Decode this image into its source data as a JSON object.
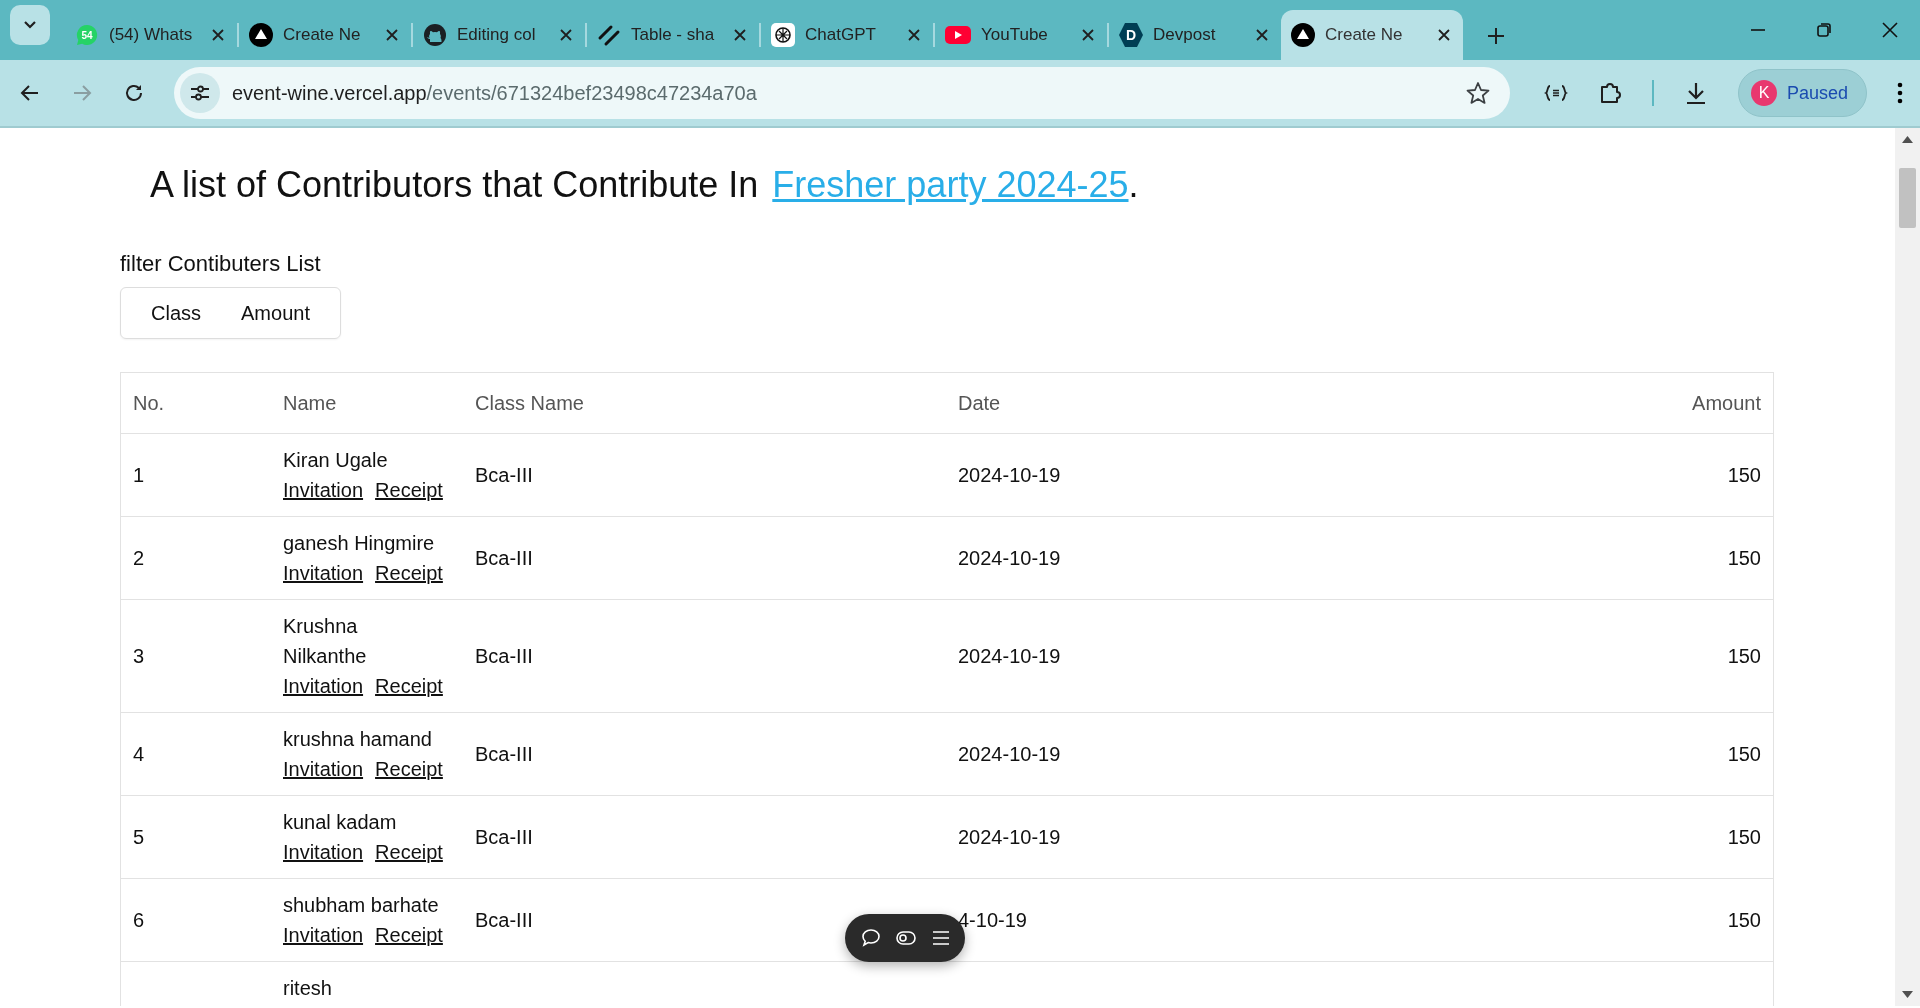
{
  "tabs": [
    {
      "title": "(54) Whats",
      "kind": "chat",
      "badge": "54",
      "selected": false
    },
    {
      "title": "Create Ne",
      "kind": "triangle",
      "selected": false
    },
    {
      "title": "Editing col",
      "kind": "cat",
      "selected": false
    },
    {
      "title": "Table - sha",
      "kind": "slash",
      "selected": false
    },
    {
      "title": "ChatGPT",
      "kind": "knot",
      "selected": false
    },
    {
      "title": "YouTube",
      "kind": "play",
      "selected": false
    },
    {
      "title": "Devpost",
      "kind": "hexagon",
      "badge": "D",
      "selected": false
    },
    {
      "title": "Create Ne",
      "kind": "triangle",
      "selected": true
    }
  ],
  "nav": {
    "forward": {
      "disabled": true
    }
  },
  "address": {
    "domain": "event-wine.vercel.app",
    "path": "/events/671324bef23498c47234a70a"
  },
  "profile": {
    "initial": "K",
    "status": "Paused"
  },
  "heading": {
    "text": "A list of Contributors that Contribute In",
    "link": "Fresher party 2024-25",
    "end": "."
  },
  "filter": {
    "label": "filter Contibuters List",
    "options": [
      "Class",
      "Amount"
    ]
  },
  "table": {
    "columns": [
      "No.",
      "Name",
      "Class Name",
      "Date",
      "Amount"
    ],
    "rows": [
      {
        "no": "1",
        "name": "Kiran Ugale",
        "links": [
          "Invitation",
          "Receipt"
        ],
        "class": "Bca-III",
        "date": "2024-10-19",
        "amount": "150"
      },
      {
        "no": "2",
        "name": "ganesh Hingmire",
        "links": [
          "Invitation",
          "Receipt"
        ],
        "class": "Bca-III",
        "date": "2024-10-19",
        "amount": "150"
      },
      {
        "no": "3",
        "name": "Krushna Nilkanthe",
        "links": [
          "Invitation",
          "Receipt"
        ],
        "class": "Bca-III",
        "date": "2024-10-19",
        "amount": "150"
      },
      {
        "no": "4",
        "name": "krushna hamand",
        "links": [
          "Invitation",
          "Receipt"
        ],
        "class": "Bca-III",
        "date": "2024-10-19",
        "amount": "150"
      },
      {
        "no": "5",
        "name": "kunal kadam",
        "links": [
          "Invitation",
          "Receipt"
        ],
        "class": "Bca-III",
        "date": "2024-10-19",
        "amount": "150"
      },
      {
        "no": "6",
        "name": "shubham barhate",
        "links": [
          "Invitation",
          "Receipt"
        ],
        "class": "Bca-III",
        "date": "4-10-19",
        "amount": "150"
      },
      {
        "name": "ritesh"
      }
    ]
  }
}
